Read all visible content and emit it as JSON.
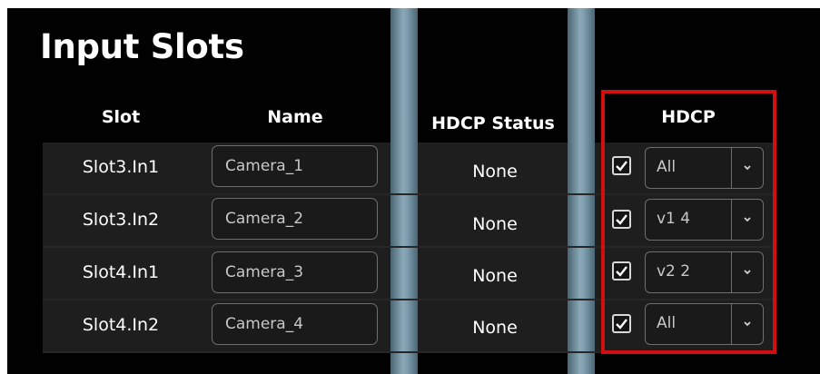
{
  "title": "Input Slots",
  "columns": {
    "slot": "Slot",
    "name": "Name",
    "hdcp_status": "HDCP Status",
    "hdcp": "HDCP"
  },
  "rows": [
    {
      "slot": "Slot3.In1",
      "name": "Camera_1",
      "status": "None",
      "hdcp_enabled": true,
      "hdcp_version": "All"
    },
    {
      "slot": "Slot3.In2",
      "name": "Camera_2",
      "status": "None",
      "hdcp_enabled": true,
      "hdcp_version": "v1 4"
    },
    {
      "slot": "Slot4.In1",
      "name": "Camera_3",
      "status": "None",
      "hdcp_enabled": true,
      "hdcp_version": "v2 2"
    },
    {
      "slot": "Slot4.In2",
      "name": "Camera_4",
      "status": "None",
      "hdcp_enabled": true,
      "hdcp_version": "All"
    }
  ],
  "icons": {
    "checkbox": "checkmark-icon",
    "dropdown": "chevron-down-icon"
  },
  "colors": {
    "background": "#010101",
    "row": "#1e1e1e",
    "highlight": "#d01010",
    "divider": "#7f9fb0"
  }
}
